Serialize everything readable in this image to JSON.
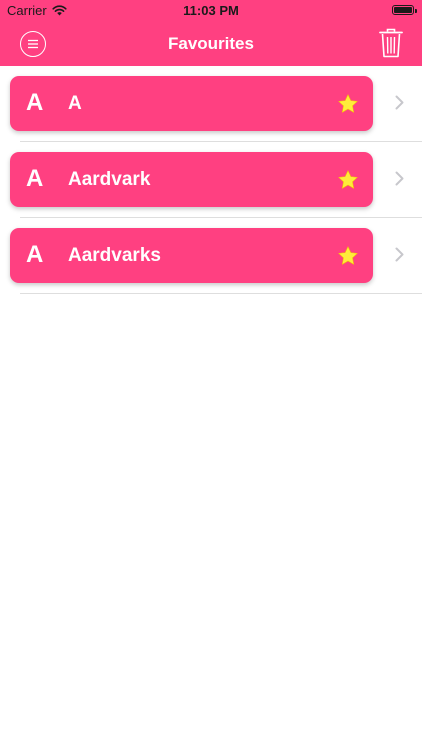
{
  "status_bar": {
    "carrier": "Carrier",
    "time": "11:03 PM"
  },
  "nav": {
    "title": "Favourites"
  },
  "favourites": [
    {
      "letter": "A",
      "word": "A",
      "favourited": true
    },
    {
      "letter": "A",
      "word": "Aardvark",
      "favourited": true
    },
    {
      "letter": "A",
      "word": "Aardvarks",
      "favourited": true
    }
  ],
  "colors": {
    "accent": "#ff4081",
    "star": "#ffeb3b",
    "chevron": "#c7c7cc"
  },
  "icons": {
    "menu": "menu-icon",
    "trash": "trash-icon",
    "star": "star-icon",
    "chevron": "chevron-right-icon"
  }
}
